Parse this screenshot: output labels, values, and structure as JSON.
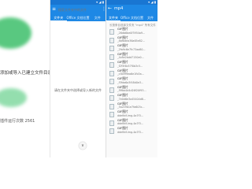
{
  "left_panel": {
    "text_line_1": "添加或导入已建立文件目录",
    "text_line_2": "插件运行次数 2561"
  },
  "middle_panel": {
    "status_icons": "▾ ◢ ▮",
    "search_placeholder": "搜索文件夹中的文件",
    "tabs": [
      {
        "label": "文件夹"
      },
      {
        "label": "Office 文档位置"
      },
      {
        "label": "文件"
      }
    ],
    "empty_message": "请在文件夹中选择或导入新的文件",
    "fab_icon": "∨"
  },
  "right_panel": {
    "status_icons": "▾ ◢ ▮",
    "title": "mp4",
    "tabs": [
      {
        "label": "文件夹"
      },
      {
        "label": "Office 文档位置"
      },
      {
        "label": "文件"
      }
    ],
    "hint": "长按条目选择文件夹 \"mp4\" 所有文件",
    "files": [
      {
        "title": "GIF图片",
        "sub": "_26db6be0f3954a9..."
      },
      {
        "title": "GIF图片",
        "sub": "_8bfbdea36a65e82..."
      },
      {
        "title": "GIF图片",
        "sub": "_2fa9c6e7fc73aa80..."
      },
      {
        "title": "GIF图片",
        "sub": "_4c8e2bdd7150e0..."
      },
      {
        "title": "GIF图片",
        "sub": "_f2f5f4b57f0b3c5..."
      },
      {
        "title": "GIF图片",
        "sub": "_c5b9f9ea6e1fb3a..."
      },
      {
        "title": "GIF图片",
        "sub": "_f3fda6a3f48d0e3..."
      },
      {
        "title": "GIF图片",
        "sub": "_f9fba4d4d26f20f93..."
      },
      {
        "title": "GIF图片",
        "sub": "_7e0d6e3a45404d8..."
      },
      {
        "title": "GIF图片",
        "sub": "_5a2c9b1e7fa603c..."
      },
      {
        "title": "GIF图片",
        "sub": "ddefbtf-img-4a7f3..."
      },
      {
        "title": "GIF图片",
        "sub": "ddefbtf-img-4a7f3..."
      },
      {
        "title": "GIF图片",
        "sub": "ddefbtf-img-4a7f3..."
      }
    ]
  },
  "colors": {
    "primary": "#1e88e5",
    "primary_dark": "#1976d2",
    "accent_green": "#3dbf6a"
  }
}
